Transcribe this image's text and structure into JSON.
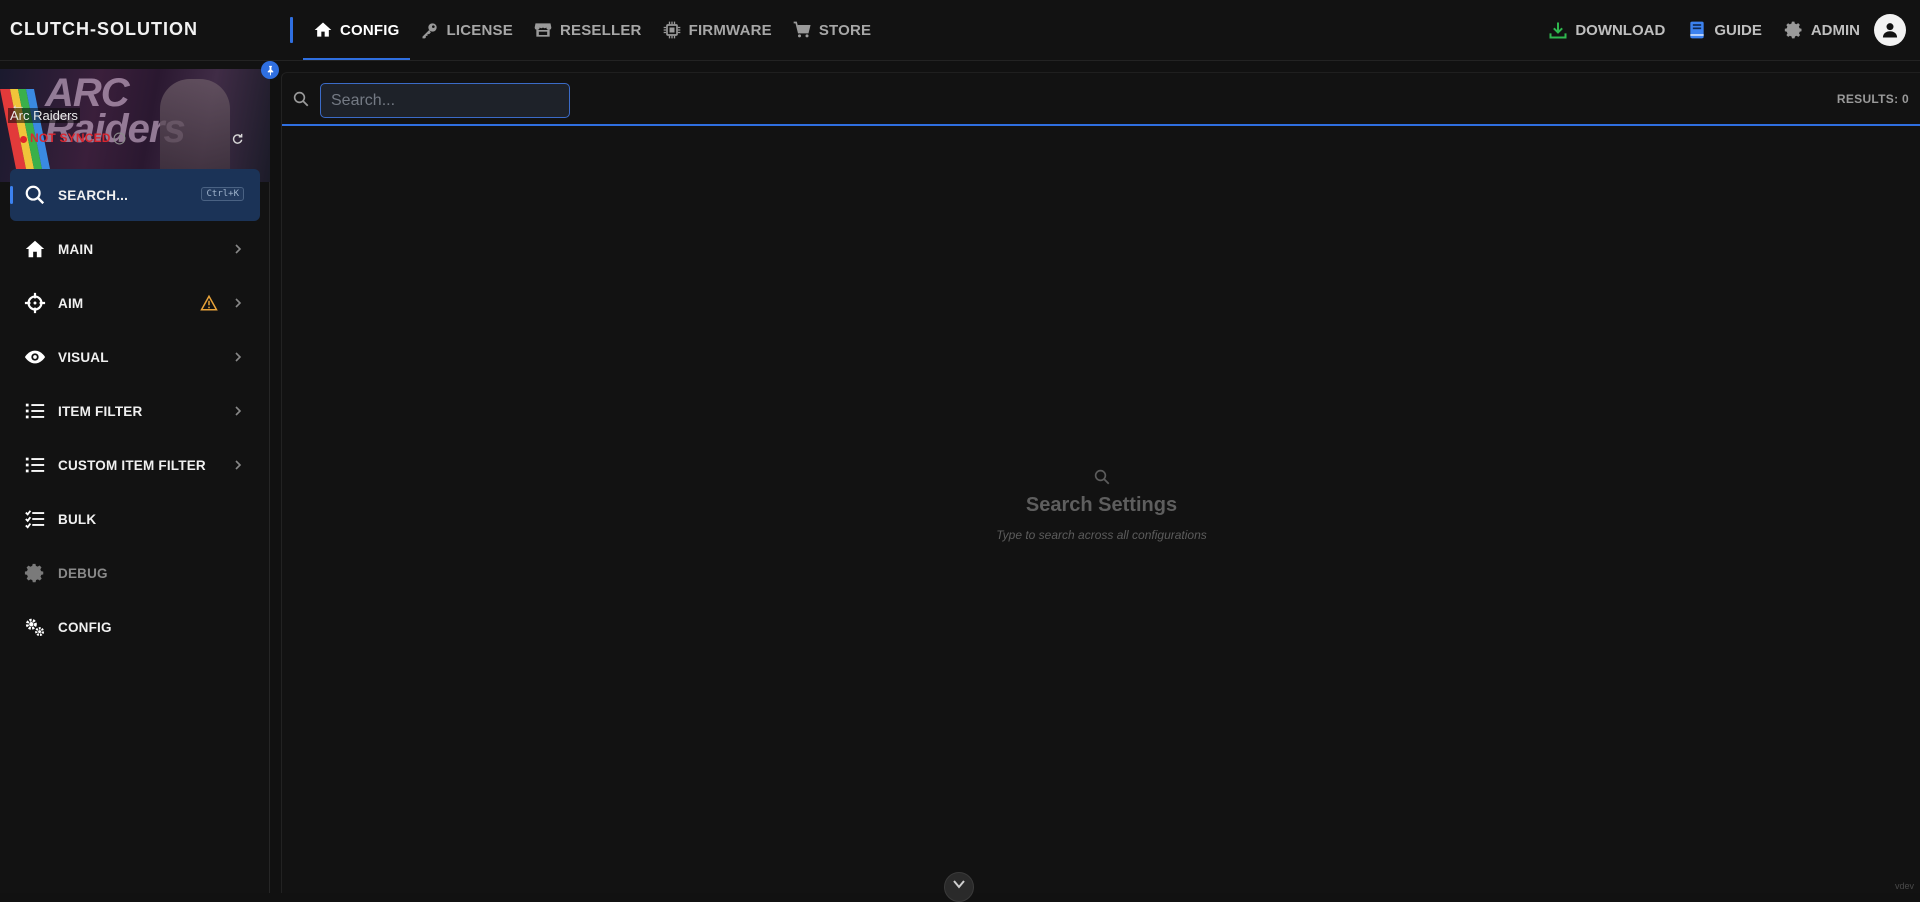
{
  "app": {
    "brand": "CLUTCH-SOLUTION"
  },
  "nav": {
    "items": [
      {
        "label": "CONFIG",
        "icon": "home-icon",
        "active": true
      },
      {
        "label": "LICENSE",
        "icon": "key-icon"
      },
      {
        "label": "RESELLER",
        "icon": "store-icon"
      },
      {
        "label": "FIRMWARE",
        "icon": "chip-icon"
      },
      {
        "label": "STORE",
        "icon": "cart-icon"
      }
    ]
  },
  "topright": {
    "download_label": "DOWNLOAD",
    "guide_label": "GUIDE",
    "admin_label": "ADMIN"
  },
  "sidebar": {
    "game": {
      "title": "Arc Raiders",
      "banner_text": "ARC Raiders"
    },
    "sync_status": "NOT SYNCED",
    "items": [
      {
        "label": "SEARCH...",
        "icon": "search-icon",
        "shortcut": "Ctrl+K",
        "active": true
      },
      {
        "label": "MAIN",
        "icon": "home-icon"
      },
      {
        "label": "AIM",
        "icon": "crosshair-icon",
        "warning": true
      },
      {
        "label": "VISUAL",
        "icon": "eye-icon"
      },
      {
        "label": "ITEM FILTER",
        "icon": "list-icon"
      },
      {
        "label": "CUSTOM ITEM FILTER",
        "icon": "list-icon"
      },
      {
        "label": "BULK",
        "icon": "checklist-icon"
      },
      {
        "label": "DEBUG",
        "icon": "gear-icon",
        "dim": true
      },
      {
        "label": "CONFIG",
        "icon": "gears-icon"
      }
    ]
  },
  "main": {
    "search": {
      "placeholder": "Search...",
      "value": ""
    },
    "results_label": "RESULTS: 0",
    "empty_title": "Search Settings",
    "empty_subtitle": "Type to search across all configurations",
    "version": "vdev"
  },
  "colors": {
    "accent": "#2f6fe0",
    "danger": "#d92730",
    "warning": "#e8a33a",
    "success": "#2fb84e"
  }
}
